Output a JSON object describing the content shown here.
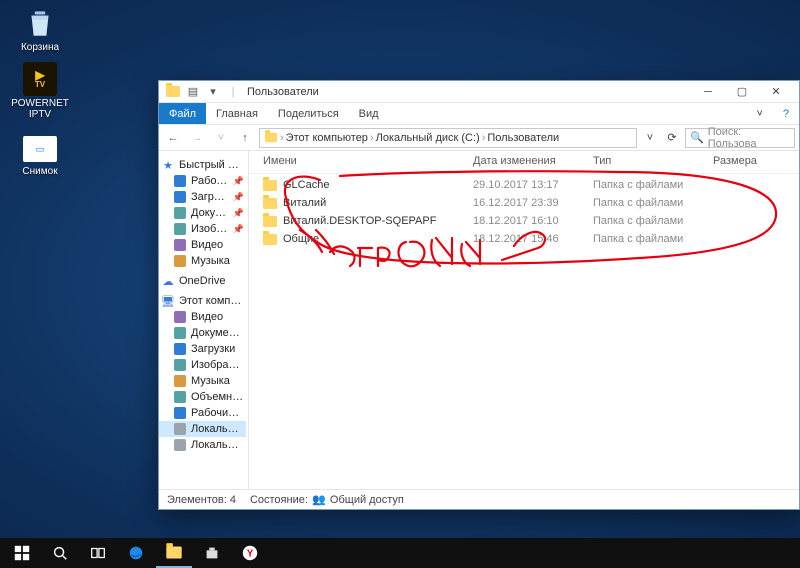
{
  "desktop": {
    "bin": "Корзина",
    "iptv_line1": "TV",
    "iptv_label": "POWERNET IPTV",
    "snap": "Снимок"
  },
  "window": {
    "title": "Пользователи",
    "tabs": {
      "file": "Файл",
      "home": "Главная",
      "share": "Поделиться",
      "view": "Вид"
    },
    "breadcrumb": {
      "pc": "Этот компьютер",
      "disk": "Локальный диск (C:)",
      "users": "Пользователи"
    },
    "search_placeholder": "Поиск: Пользова",
    "columns": {
      "name": "Имени",
      "date": "Дата изменения",
      "type": "Тип",
      "size": "Размера"
    },
    "rows": [
      {
        "name": "GLCache",
        "date": "29.10.2017 13:17",
        "type": "Папка с файлами"
      },
      {
        "name": "Виталий",
        "date": "16.12.2017 23:39",
        "type": "Папка с файлами"
      },
      {
        "name": "Виталий.DESKTOP-SQEPAPF",
        "date": "18.12.2017 16:10",
        "type": "Папка с файлами"
      },
      {
        "name": "Общие",
        "date": "18.12.2017 15:46",
        "type": "Папка с файлами"
      }
    ],
    "tree": {
      "quick": "Быстрый доступ",
      "quick_items": [
        {
          "label": "Рабочий стол",
          "color": "c-blue",
          "pin": true
        },
        {
          "label": "Загрузки",
          "color": "c-blue",
          "pin": true
        },
        {
          "label": "Документы",
          "color": "c-teal",
          "pin": true
        },
        {
          "label": "Изображения",
          "color": "c-teal",
          "pin": true
        },
        {
          "label": "Видео",
          "color": "c-purple"
        },
        {
          "label": "Музыка",
          "color": "c-orange"
        }
      ],
      "onedrive": "OneDrive",
      "thispc": "Этот компьютер",
      "pc_items": [
        {
          "label": "Видео",
          "color": "c-purple"
        },
        {
          "label": "Документы",
          "color": "c-teal"
        },
        {
          "label": "Загрузки",
          "color": "c-blue"
        },
        {
          "label": "Изображения",
          "color": "c-teal"
        },
        {
          "label": "Музыка",
          "color": "c-orange"
        },
        {
          "label": "Объемные объекты",
          "color": "c-teal"
        },
        {
          "label": "Рабочий стол",
          "color": "c-blue"
        },
        {
          "label": "Локальный диск",
          "color": "c-gray",
          "sel": true
        },
        {
          "label": "Локальный диск",
          "color": "c-gray"
        }
      ]
    },
    "status": {
      "count": "Элементов: 4",
      "state_label": "Состояние:",
      "state_value": "Общий доступ"
    }
  }
}
